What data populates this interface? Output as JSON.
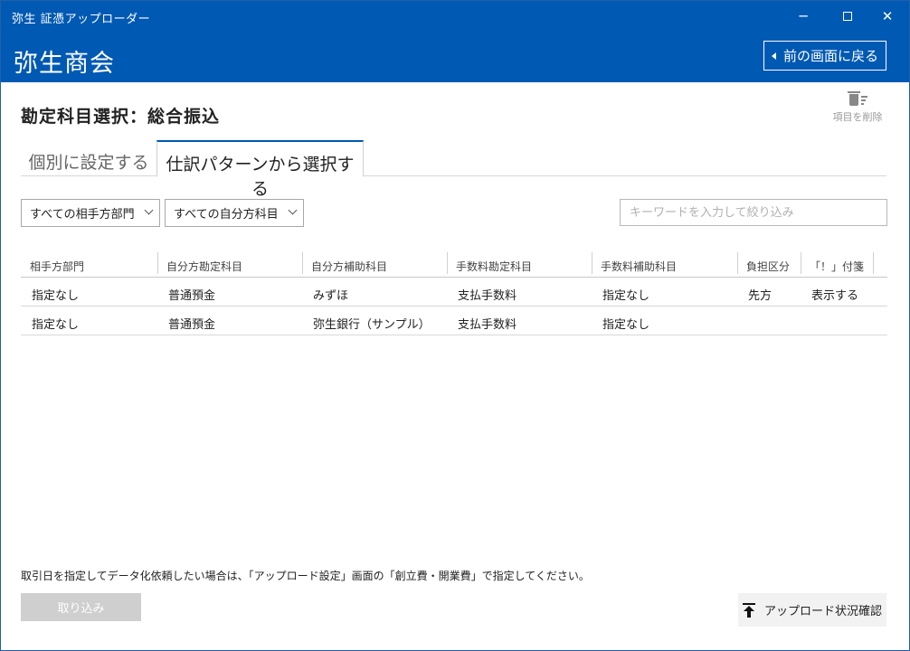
{
  "window": {
    "title": "弥生 証憑アップローダー"
  },
  "header": {
    "company": "弥生商会",
    "back_label": "前の画面に戻る"
  },
  "page": {
    "title": "勘定科目選択：総合振込",
    "delete_label": "項目を削除"
  },
  "tabs": [
    {
      "label": "個別に設定する",
      "active": false
    },
    {
      "label": "仕訳パターンから選択する",
      "active": true
    }
  ],
  "filters": {
    "partner_dept": "すべての相手方部門",
    "own_account": "すべての自分方科目",
    "search_placeholder": "キーワードを入力して絞り込み",
    "search_value": ""
  },
  "table": {
    "columns": [
      "相手方部門",
      "自分方勘定科目",
      "自分方補助科目",
      "手数料勘定科目",
      "手数料補助科目",
      "負担区分",
      "「！」付箋"
    ],
    "rows": [
      [
        "指定なし",
        "普通預金",
        "みずほ",
        "支払手数料",
        "指定なし",
        "先方",
        "表示する"
      ],
      [
        "指定なし",
        "普通預金",
        "弥生銀行（サンプル）",
        "支払手数料",
        "指定なし",
        "",
        ""
      ]
    ]
  },
  "footer": {
    "note": "取引日を指定してデータ化依頼したい場合は、「アップロード設定」画面の「創立費・開業費」で指定してください。",
    "import_label": "取り込み",
    "status_label": "アップロード状況確認"
  },
  "colors": {
    "brand": "#0059b3",
    "disabled_button": "#cfcfcf"
  }
}
